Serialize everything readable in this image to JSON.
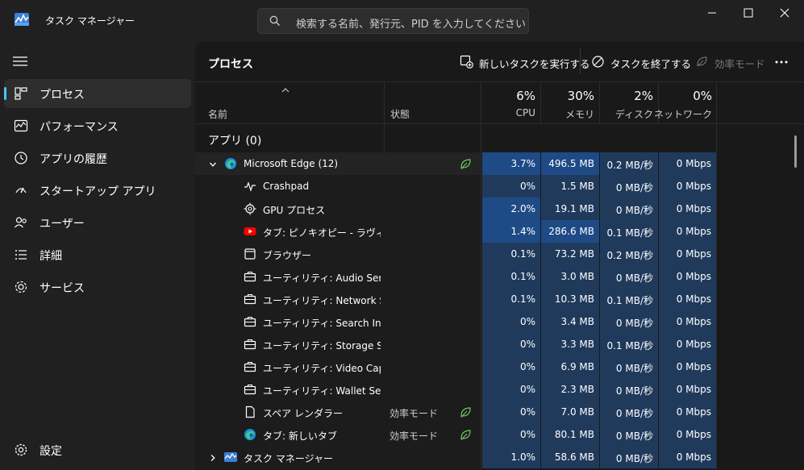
{
  "window": {
    "title": "タスク マネージャー",
    "search_placeholder": "検索する名前、発行元、PID を入力してください"
  },
  "sidebar": {
    "items": [
      {
        "label": "プロセス",
        "icon": "processes-icon",
        "active": true
      },
      {
        "label": "パフォーマンス",
        "icon": "performance-icon",
        "active": false
      },
      {
        "label": "アプリの履歴",
        "icon": "app-history-icon",
        "active": false
      },
      {
        "label": "スタートアップ アプリ",
        "icon": "startup-icon",
        "active": false
      },
      {
        "label": "ユーザー",
        "icon": "users-icon",
        "active": false
      },
      {
        "label": "詳細",
        "icon": "details-icon",
        "active": false
      },
      {
        "label": "サービス",
        "icon": "services-icon",
        "active": false
      }
    ],
    "settings_label": "設定"
  },
  "toolbar": {
    "title": "プロセス",
    "run_new_task": "新しいタスクを実行する",
    "end_task": "タスクを終了する",
    "efficiency_mode": "効率モード"
  },
  "columns": {
    "name": "名前",
    "status": "状態",
    "cpu": {
      "pct": "6%",
      "label": "CPU"
    },
    "memory": {
      "pct": "30%",
      "label": "メモリ"
    },
    "disk": {
      "pct": "2%",
      "label": "ディスク"
    },
    "network": {
      "pct": "0%",
      "label": "ネットワーク"
    }
  },
  "group": {
    "label": "アプリ (0)"
  },
  "rows": [
    {
      "name": "Microsoft Edge (12)",
      "icon": "edge-icon",
      "status": "",
      "leaf": true,
      "cpu": "3.7%",
      "mem": "496.5 MB",
      "disk": "0.2 MB/秒",
      "net": "0 Mbps"
    },
    {
      "name": "Crashpad",
      "icon": "pulse-icon",
      "status": "",
      "leaf": false,
      "cpu": "0%",
      "mem": "1.5 MB",
      "disk": "0 MB/秒",
      "net": "0 Mbps"
    },
    {
      "name": "GPU プロセス",
      "icon": "gpu-icon",
      "status": "",
      "leaf": false,
      "cpu": "2.0%",
      "mem": "19.1 MB",
      "disk": "0 MB/秒",
      "net": "0 Mbps"
    },
    {
      "name": "タブ: ピノキオピー - ラヴィット ...",
      "icon": "youtube-icon",
      "status": "",
      "leaf": false,
      "cpu": "1.4%",
      "mem": "286.6 MB",
      "disk": "0.1 MB/秒",
      "net": "0 Mbps"
    },
    {
      "name": "ブラウザー",
      "icon": "window-icon",
      "status": "",
      "leaf": false,
      "cpu": "0.1%",
      "mem": "73.2 MB",
      "disk": "0.2 MB/秒",
      "net": "0 Mbps"
    },
    {
      "name": "ユーティリティ: Audio Service",
      "icon": "briefcase-icon",
      "status": "",
      "leaf": false,
      "cpu": "0.1%",
      "mem": "3.0 MB",
      "disk": "0 MB/秒",
      "net": "0 Mbps"
    },
    {
      "name": "ユーティリティ: Network Ser...",
      "icon": "briefcase-icon",
      "status": "",
      "leaf": false,
      "cpu": "0.1%",
      "mem": "10.3 MB",
      "disk": "0.1 MB/秒",
      "net": "0 Mbps"
    },
    {
      "name": "ユーティリティ: Search Index...",
      "icon": "briefcase-icon",
      "status": "",
      "leaf": false,
      "cpu": "0%",
      "mem": "3.4 MB",
      "disk": "0 MB/秒",
      "net": "0 Mbps"
    },
    {
      "name": "ユーティリティ: Storage Service",
      "icon": "briefcase-icon",
      "status": "",
      "leaf": false,
      "cpu": "0%",
      "mem": "3.3 MB",
      "disk": "0.1 MB/秒",
      "net": "0 Mbps"
    },
    {
      "name": "ユーティリティ: Video Capture",
      "icon": "briefcase-icon",
      "status": "",
      "leaf": false,
      "cpu": "0%",
      "mem": "6.9 MB",
      "disk": "0 MB/秒",
      "net": "0 Mbps"
    },
    {
      "name": "ユーティリティ: Wallet Service",
      "icon": "briefcase-icon",
      "status": "",
      "leaf": false,
      "cpu": "0%",
      "mem": "2.3 MB",
      "disk": "0 MB/秒",
      "net": "0 Mbps"
    },
    {
      "name": "スペア レンダラー",
      "icon": "file-icon",
      "status": "効率モード",
      "leaf": true,
      "cpu": "0%",
      "mem": "7.0 MB",
      "disk": "0 MB/秒",
      "net": "0 Mbps"
    },
    {
      "name": "タブ: 新しいタブ",
      "icon": "edge-icon",
      "status": "効率モード",
      "leaf": true,
      "cpu": "0%",
      "mem": "80.1 MB",
      "disk": "0 MB/秒",
      "net": "0 Mbps"
    },
    {
      "name": "タスク マネージャー",
      "icon": "taskmgr-icon",
      "status": "",
      "leaf": false,
      "cpu": "1.0%",
      "mem": "58.6 MB",
      "disk": "0 MB/秒",
      "net": "0 Mbps"
    }
  ],
  "colors": {
    "accent": "#4cc2ff",
    "heat_low": "#1b3250",
    "heat_mid": "#203a5c",
    "heat_high": "#1e4a86",
    "leaf_green": "#6ccb5f"
  }
}
